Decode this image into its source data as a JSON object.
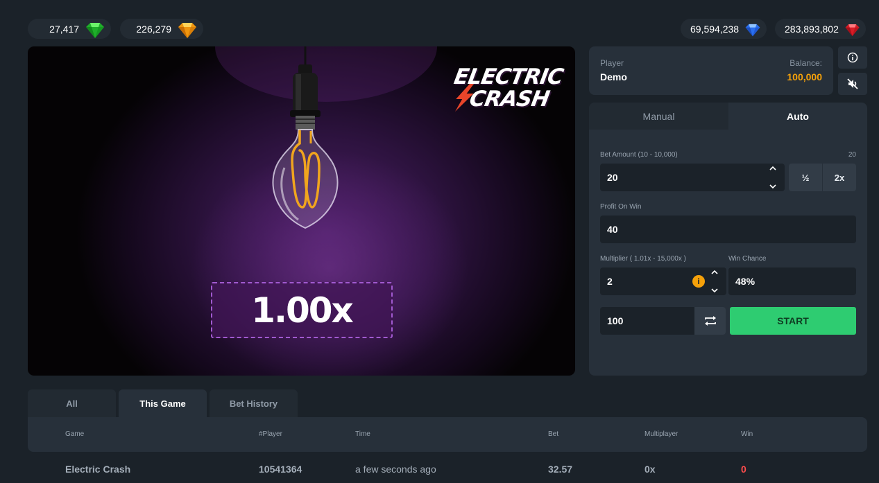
{
  "jackpots": [
    {
      "amount": "27,417",
      "gem": "green-gem-icon",
      "color": "#2ecc40"
    },
    {
      "amount": "226,279",
      "gem": "orange-gem-icon",
      "color": "#f39c12"
    },
    {
      "amount": "69,594,238",
      "gem": "blue-gem-icon",
      "color": "#2f7cf6"
    },
    {
      "amount": "283,893,802",
      "gem": "red-gem-icon",
      "color": "#e0202a"
    }
  ],
  "game": {
    "logo_line1": "ELECTRIC",
    "logo_line2": "CRASH",
    "multiplier": "1.00x"
  },
  "player": {
    "player_label": "Player",
    "player_name": "Demo",
    "balance_label": "Balance:",
    "balance_value": "100,000"
  },
  "controls": {
    "tab_manual": "Manual",
    "tab_auto": "Auto",
    "bet_amount_label": "Bet Amount (10 - 10,000)",
    "bet_amount_right": "20",
    "bet_amount_value": "20",
    "half_label": "½",
    "double_label": "2x",
    "profit_label": "Profit On Win",
    "profit_value": "40",
    "multiplier_label": "Multiplier ( 1.01x - 15,000x )",
    "multiplier_value": "2",
    "win_chance_label": "Win Chance",
    "win_chance_value": "48%",
    "auto_count_value": "100",
    "start_label": "START"
  },
  "history": {
    "tabs": [
      "All",
      "This Game",
      "Bet History"
    ],
    "active_tab": "This Game",
    "columns": [
      "Game",
      "#Player",
      "Time",
      "Bet",
      "Multiplayer",
      "Win"
    ],
    "rows": [
      {
        "game": "Electric Crash",
        "player": "10541364",
        "time": "a few seconds ago",
        "bet": "32.57",
        "multiplier": "0x",
        "win": "0"
      }
    ]
  },
  "colors": {
    "accent_green": "#2ecc71",
    "balance_orange": "#f5a10a",
    "loss_red": "#ff4d4d",
    "multiplier_border": "#a15ad0"
  }
}
